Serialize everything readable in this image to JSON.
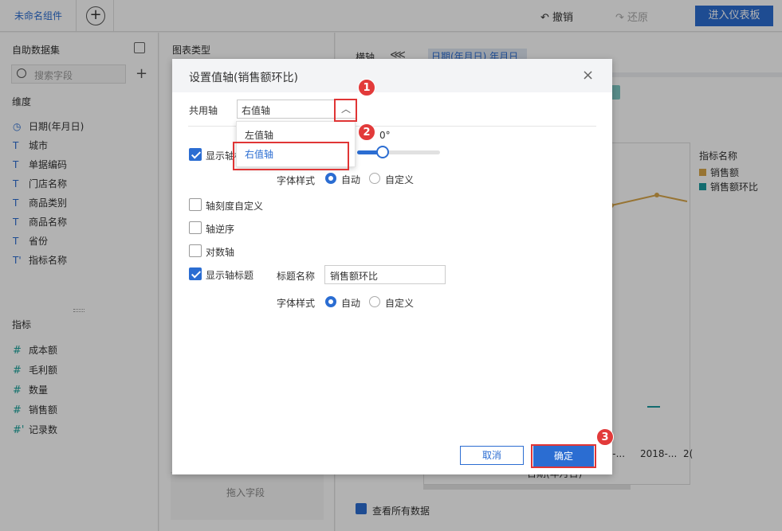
{
  "topbar": {
    "tab": "未命名组件",
    "add": "+",
    "undo": "撤销",
    "undo_icon": "↶",
    "redo": "还原",
    "redo_icon": "↷",
    "enter_dashboard": "进入仪表板"
  },
  "left": {
    "dataset_title": "自助数据集",
    "search_placeholder": "搜索字段",
    "dimension_title": "维度",
    "dimensions": [
      {
        "icon": "◷",
        "label": "日期(年月日)"
      },
      {
        "icon": "T",
        "label": "城市"
      },
      {
        "icon": "T",
        "label": "单据编码"
      },
      {
        "icon": "T",
        "label": "门店名称"
      },
      {
        "icon": "T",
        "label": "商品类别"
      },
      {
        "icon": "T",
        "label": "商品名称"
      },
      {
        "icon": "T",
        "label": "省份"
      },
      {
        "icon": "T'",
        "label": "指标名称"
      }
    ],
    "metric_title": "指标",
    "metrics": [
      {
        "icon": "#",
        "label": "成本额"
      },
      {
        "icon": "#",
        "label": "毛利额"
      },
      {
        "icon": "#",
        "label": "数量"
      },
      {
        "icon": "#",
        "label": "销售额"
      },
      {
        "icon": "#'",
        "label": "记录数"
      }
    ]
  },
  "middle": {
    "chart_type_title": "图表类型",
    "drop_hint": "拖入字段"
  },
  "right": {
    "horizontal_axis": "横轴",
    "axis_field": "日期(年月日)  年月日",
    "legend_title": "指标名称",
    "legend": [
      {
        "label": "销售额",
        "color": "#d8a64a"
      },
      {
        "label": "销售额环比",
        "color": "#1a9aa0"
      }
    ],
    "x_ticks": [
      "18-...",
      "2018-...",
      "2("
    ],
    "x_title": "日期(年月日)",
    "view_all": "查看所有数据"
  },
  "dialog": {
    "title": "设置值轴(销售额环比)",
    "close": "×",
    "shared_axis_label": "共用轴",
    "shared_axis_value": "右值轴",
    "dropdown_options": [
      "左值轴",
      "右值轴"
    ],
    "show_axis_label": "显示轴标",
    "rotation_value": "0°",
    "font_style_label": "字体样式",
    "radio_auto": "自动",
    "radio_custom": "自定义",
    "custom_scale": "轴刻度自定义",
    "reverse": "轴逆序",
    "log_axis": "对数轴",
    "show_axis_title": "显示轴标题",
    "title_name_label": "标题名称",
    "title_name_value": "销售额环比",
    "cancel": "取消",
    "ok": "确定"
  },
  "annotations": [
    "1",
    "2",
    "3"
  ],
  "colors": {
    "accent": "#2b6dd2",
    "annotation": "#e03535"
  }
}
